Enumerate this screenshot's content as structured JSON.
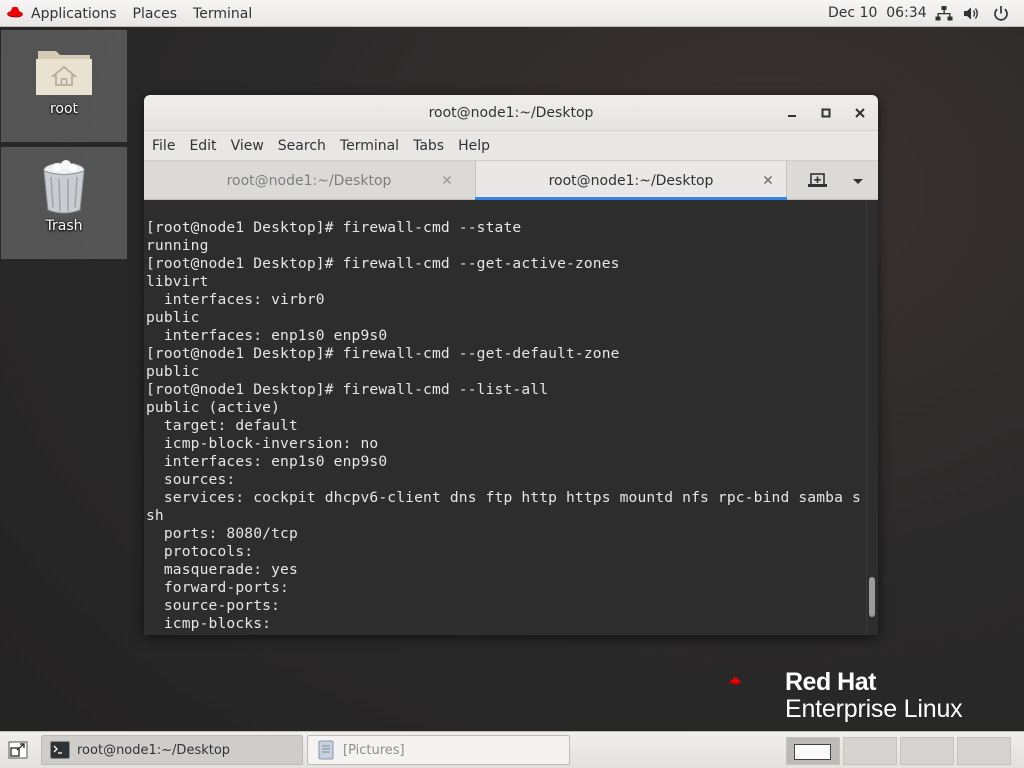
{
  "topbar": {
    "applications": "Applications",
    "places": "Places",
    "terminal": "Terminal",
    "clock": "Dec 10  06:34"
  },
  "desktop": {
    "icons": [
      {
        "label": "root",
        "icon": "home-folder-icon"
      },
      {
        "label": "Trash",
        "icon": "trash-icon"
      }
    ]
  },
  "window": {
    "title": "root@node1:~/Desktop",
    "menu": [
      "File",
      "Edit",
      "View",
      "Search",
      "Terminal",
      "Tabs",
      "Help"
    ],
    "tabs": [
      {
        "label": "root@node1:~/Desktop",
        "active": false
      },
      {
        "label": "root@node1:~/Desktop",
        "active": true
      }
    ]
  },
  "terminal_lines": [
    "[root@node1 Desktop]# firewall-cmd --state",
    "running",
    "[root@node1 Desktop]# firewall-cmd --get-active-zones",
    "libvirt",
    "  interfaces: virbr0",
    "public",
    "  interfaces: enp1s0 enp9s0",
    "[root@node1 Desktop]# firewall-cmd --get-default-zone",
    "public",
    "[root@node1 Desktop]# firewall-cmd --list-all",
    "public (active)",
    "  target: default",
    "  icmp-block-inversion: no",
    "  interfaces: enp1s0 enp9s0",
    "  sources:",
    "  services: cockpit dhcpv6-client dns ftp http https mountd nfs rpc-bind samba s",
    "sh",
    "  ports: 8080/tcp",
    "  protocols:",
    "  masquerade: yes",
    "  forward-ports:",
    "  source-ports:",
    "  icmp-blocks:"
  ],
  "branding": {
    "line1": "Red Hat",
    "line2": "Enterprise Linux"
  },
  "taskbar": {
    "tasks": [
      {
        "label": "root@node1:~/Desktop",
        "active": true
      },
      {
        "label": "[Pictures]",
        "active": false
      }
    ]
  },
  "colors": {
    "accent": "#3584e4",
    "redhat": "#ee0000",
    "terminal_bg": "#2d2d2d",
    "terminal_fg": "#e6e6e6"
  }
}
